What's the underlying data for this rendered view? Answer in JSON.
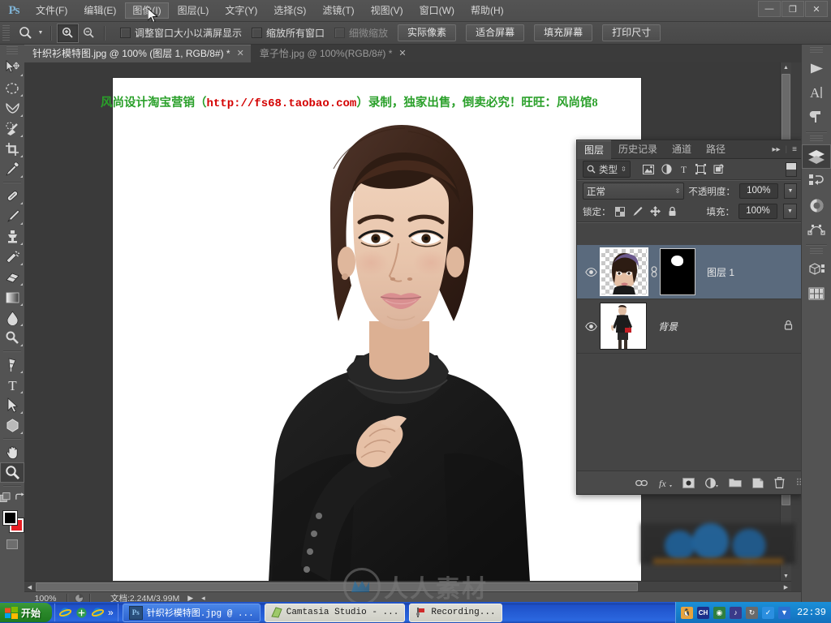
{
  "app": {
    "name": "Adobe Photoshop",
    "logo_text": "Ps"
  },
  "menubar": {
    "items": [
      {
        "label": "文件(F)",
        "active": false
      },
      {
        "label": "编辑(E)",
        "active": false
      },
      {
        "label": "图像(I)",
        "active": true
      },
      {
        "label": "图层(L)",
        "active": false
      },
      {
        "label": "文字(Y)",
        "active": false
      },
      {
        "label": "选择(S)",
        "active": false
      },
      {
        "label": "滤镜(T)",
        "active": false
      },
      {
        "label": "视图(V)",
        "active": false
      },
      {
        "label": "窗口(W)",
        "active": false
      },
      {
        "label": "帮助(H)",
        "active": false
      }
    ],
    "window_controls": {
      "minimize": "—",
      "restore": "❐",
      "close": "✕"
    }
  },
  "options_bar": {
    "active_tool": "zoom-tool",
    "zoom_in_label": "zoom-in",
    "zoom_out_label": "zoom-out",
    "checkboxes": [
      {
        "label": "调整窗口大小以满屏显示",
        "checked": false,
        "enabled": true
      },
      {
        "label": "缩放所有窗口",
        "checked": false,
        "enabled": true
      },
      {
        "label": "细微缩放",
        "checked": false,
        "enabled": false
      }
    ],
    "buttons": [
      "实际像素",
      "适合屏幕",
      "填充屏幕",
      "打印尺寸"
    ]
  },
  "toolbox": {
    "tools": [
      {
        "name": "move-tool",
        "selected": false
      },
      {
        "name": "elliptical-marquee-tool",
        "selected": false
      },
      {
        "name": "lasso-tool",
        "selected": false
      },
      {
        "name": "quick-selection-tool",
        "selected": false
      },
      {
        "name": "crop-tool",
        "selected": false
      },
      {
        "name": "eyedropper-tool",
        "selected": false
      },
      {
        "name": "healing-brush-tool",
        "selected": false
      },
      {
        "name": "brush-tool",
        "selected": false
      },
      {
        "name": "clone-stamp-tool",
        "selected": false
      },
      {
        "name": "history-brush-tool",
        "selected": false
      },
      {
        "name": "eraser-tool",
        "selected": false
      },
      {
        "name": "gradient-tool",
        "selected": false
      },
      {
        "name": "blur-tool",
        "selected": false
      },
      {
        "name": "dodge-tool",
        "selected": false
      },
      {
        "name": "pen-tool",
        "selected": false
      },
      {
        "name": "type-tool",
        "selected": false
      },
      {
        "name": "path-selection-tool",
        "selected": false
      },
      {
        "name": "shape-tool",
        "selected": false
      },
      {
        "name": "hand-tool",
        "selected": false
      },
      {
        "name": "zoom-tool",
        "selected": true
      }
    ],
    "foreground_color": "#000000",
    "background_color": "#e81e23"
  },
  "document_tabs": [
    {
      "title": "针织衫模特图.jpg @ 100% (图层 1, RGB/8#) *",
      "active": true,
      "close": "✕"
    },
    {
      "title": "章子怡.jpg @ 100%(RGB/8#) *",
      "active": false,
      "close": "✕"
    }
  ],
  "canvas": {
    "watermark_line": {
      "prefix": "风尚设计淘宝营销（",
      "url": "http://fs68.taobao.com",
      "suffix": "）录制，独家出售，倒卖必究！旺旺：风尚馆8",
      "prefix_color": "#2aa02a",
      "url_color": "#d40000"
    },
    "overlay_watermark": "人人素材"
  },
  "status_bar": {
    "zoom": "100%",
    "doc_info": "文档:2.24M/3.99M",
    "play_arrow": "▶",
    "more_arrow": "◂"
  },
  "layers_panel": {
    "tabs": [
      {
        "label": "图层",
        "active": true
      },
      {
        "label": "历史记录",
        "active": false
      },
      {
        "label": "通道",
        "active": false
      },
      {
        "label": "路径",
        "active": false
      }
    ],
    "tab_buttons": {
      "collapse": "▸▸",
      "menu": "≡"
    },
    "filter": {
      "icon": "search-icon",
      "value": "类型",
      "spinner": "⇕"
    },
    "filter_icons": [
      "pixel-layer-filter-icon",
      "adjustment-layer-filter-icon",
      "type-layer-filter-icon",
      "shape-layer-filter-icon",
      "smart-object-filter-icon"
    ],
    "blend_mode": "正常",
    "opacity_label": "不透明度：",
    "opacity_value": "100%",
    "lock_label": "锁定：",
    "lock_icons": [
      "lock-transparent-pixels-icon",
      "lock-image-pixels-icon",
      "lock-position-icon",
      "lock-all-icon"
    ],
    "fill_label": "填充：",
    "fill_value": "100%",
    "layers": [
      {
        "name": "图层 1",
        "visible": true,
        "selected": true,
        "has_mask": true,
        "locked": false,
        "thumb_type": "transparent-portrait",
        "link_icon": "link-icon"
      },
      {
        "name": "背景",
        "visible": true,
        "selected": false,
        "has_mask": false,
        "locked": true,
        "thumb_type": "full-body-model",
        "lock_icon": "lock-icon"
      }
    ],
    "bottom_buttons": [
      {
        "name": "link-layers-button",
        "glyph": "⛓"
      },
      {
        "name": "layer-style-button",
        "glyph": "fx"
      },
      {
        "name": "add-layer-mask-button",
        "glyph": "◉"
      },
      {
        "name": "new-fill-adjustment-button",
        "glyph": "◑"
      },
      {
        "name": "new-group-button",
        "glyph": "🗀"
      },
      {
        "name": "new-layer-button",
        "glyph": "❏"
      },
      {
        "name": "delete-layer-button",
        "glyph": "🗑"
      }
    ]
  },
  "right_dock": {
    "items": [
      {
        "name": "tool-presets-icon",
        "glyph": "▶",
        "selected": false
      },
      {
        "name": "character-panel-icon",
        "glyph": "A",
        "selected": false
      },
      {
        "name": "paragraph-panel-icon",
        "glyph": "¶",
        "selected": false
      },
      {
        "name": "layers-panel-icon",
        "glyph": "◈",
        "selected": true
      },
      {
        "name": "adjustments-panel-icon",
        "glyph": "⬓",
        "selected": false
      },
      {
        "name": "color-panel-icon",
        "glyph": "◕",
        "selected": false
      },
      {
        "name": "paths-panel-icon",
        "glyph": "⤳",
        "selected": false
      },
      {
        "name": "3d-panel-icon",
        "glyph": "⬚",
        "selected": false
      },
      {
        "name": "histogram-panel-icon",
        "glyph": "▦",
        "selected": false
      }
    ]
  },
  "taskbar": {
    "start_label": "开始",
    "quick_launch": [
      "internet-explorer-icon",
      "browser-icon",
      "internet-explorer-icon"
    ],
    "quick_launch_more": "»",
    "tasks": [
      {
        "icon": "photoshop-icon",
        "label": "针织衫模特图.jpg @ ...",
        "active": true
      },
      {
        "icon": "camtasia-icon",
        "label": "Camtasia Studio - ...",
        "active": false
      },
      {
        "icon": "recorder-icon",
        "label": "Recording...",
        "active": false
      }
    ],
    "tray_icons": [
      "qq-icon",
      "ime-icon",
      "network-icon",
      "sound-icon",
      "update-icon",
      "shield-icon",
      "antivirus-icon"
    ],
    "ime_label": "CH",
    "clock": "22:39"
  }
}
